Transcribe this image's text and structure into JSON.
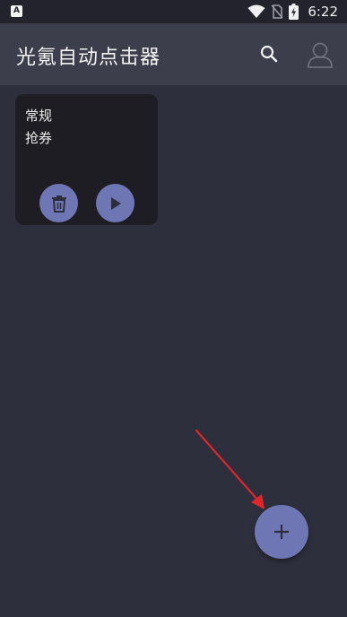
{
  "status_bar": {
    "notification_icon_letter": "A",
    "time": "6:22",
    "icons": [
      "wifi-icon",
      "no-sim-icon",
      "battery-charging-icon"
    ]
  },
  "app_bar": {
    "title": "光氪自动点击器",
    "icons": [
      "search-icon",
      "account-icon"
    ]
  },
  "scripts": [
    {
      "name": "常规",
      "description": "抢券",
      "actions": [
        "delete-icon",
        "play-icon"
      ]
    }
  ],
  "fab": {
    "icon": "plus-icon"
  },
  "colors": {
    "background": "#2e2f3d",
    "app_bar": "#3c3e4c",
    "status_bar": "#22232d",
    "card": "#1e1d24",
    "accent": "#6e76b4",
    "annotation_arrow": "#e0262b"
  }
}
